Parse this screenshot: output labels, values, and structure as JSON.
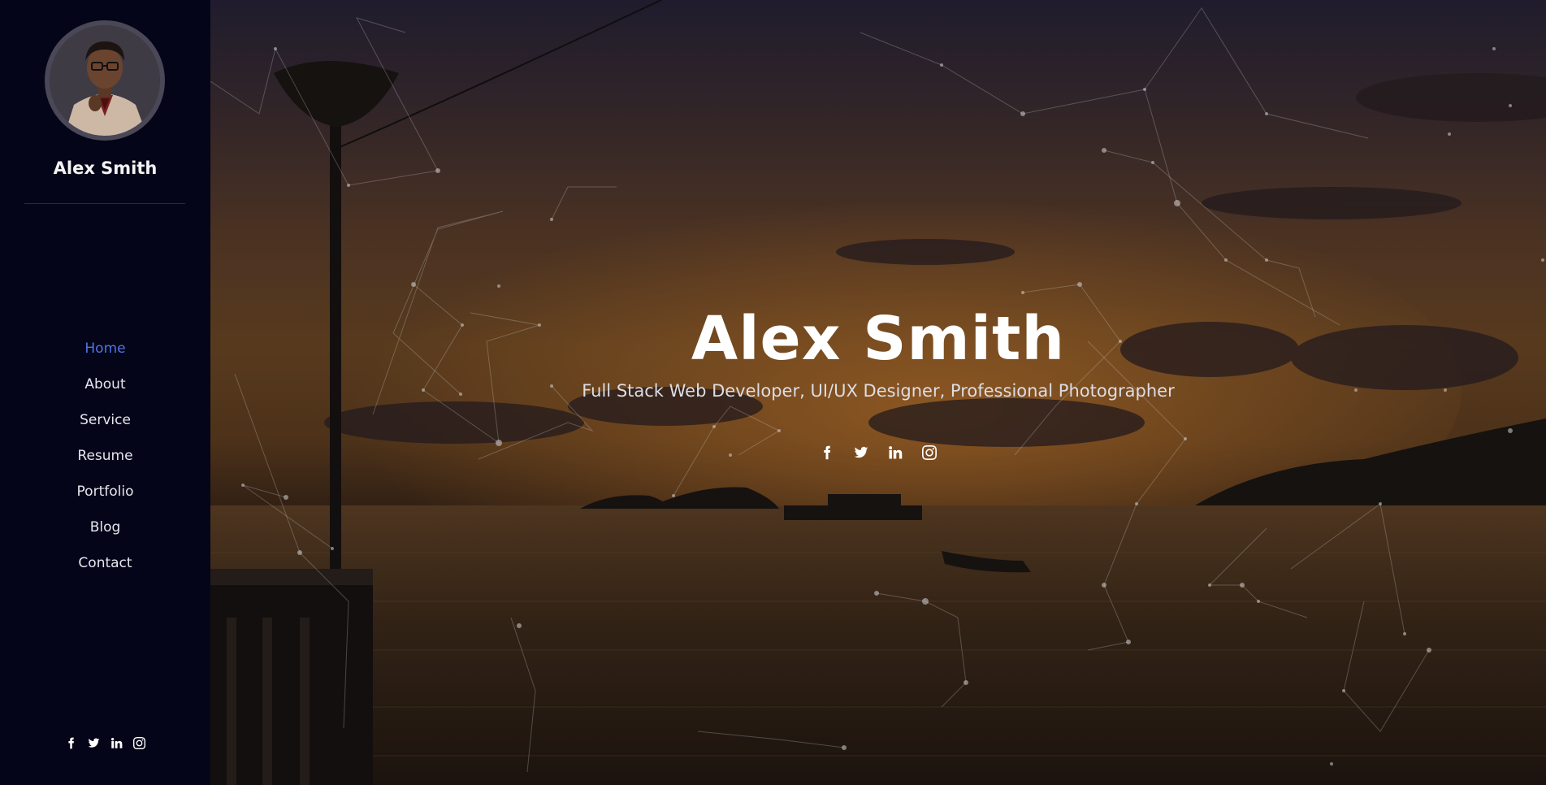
{
  "sidebar": {
    "name": "Alex Smith",
    "nav": [
      {
        "label": "Home",
        "active": true
      },
      {
        "label": "About",
        "active": false
      },
      {
        "label": "Service",
        "active": false
      },
      {
        "label": "Resume",
        "active": false
      },
      {
        "label": "Portfolio",
        "active": false
      },
      {
        "label": "Blog",
        "active": false
      },
      {
        "label": "Contact",
        "active": false
      }
    ],
    "social_icons": [
      "facebook-icon",
      "twitter-icon",
      "linkedin-icon",
      "instagram-icon"
    ]
  },
  "hero": {
    "title": "Alex Smith",
    "subtitle": "Full Stack Web Developer, UI/UX Designer, Professional Photographer",
    "social_icons": [
      "facebook-icon",
      "twitter-icon",
      "linkedin-icon",
      "instagram-icon"
    ]
  },
  "colors": {
    "sidebar_bg": "#050519",
    "accent": "#4f74e6",
    "text": "#ffffff"
  }
}
